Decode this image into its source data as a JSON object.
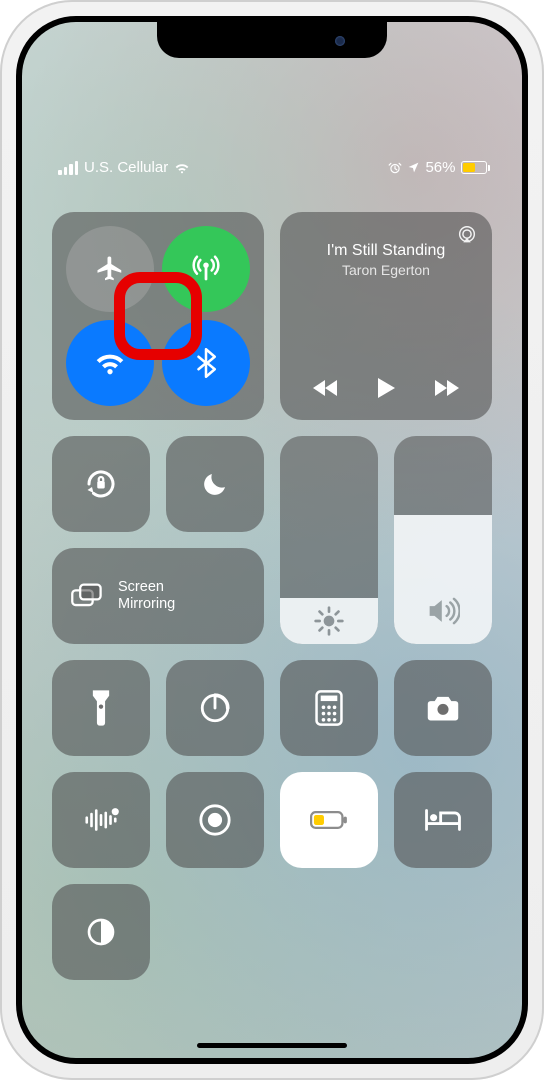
{
  "status": {
    "carrier": "U.S. Cellular",
    "battery_percent_text": "56%",
    "battery_fill_pct": 56
  },
  "connectivity": {
    "airplane": {
      "active": false
    },
    "cellular": {
      "active": true
    },
    "wifi": {
      "active": true
    },
    "bluetooth": {
      "active": true
    }
  },
  "music": {
    "title": "I'm Still Standing",
    "artist": "Taron Egerton"
  },
  "screen_mirroring": {
    "label": "Screen\nMirroring"
  },
  "brightness_pct": 22,
  "volume_pct": 62,
  "tiles": {
    "orientation_lock": "orientation-lock",
    "dnd": "do-not-disturb",
    "flashlight": "flashlight",
    "timer": "timer",
    "calculator": "calculator",
    "camera": "camera",
    "voice_memo": "voice-memo",
    "screen_record": "screen-record",
    "low_power": "low-power-mode",
    "sleep": "sleep-mode",
    "dark_mode": "dark-mode"
  }
}
